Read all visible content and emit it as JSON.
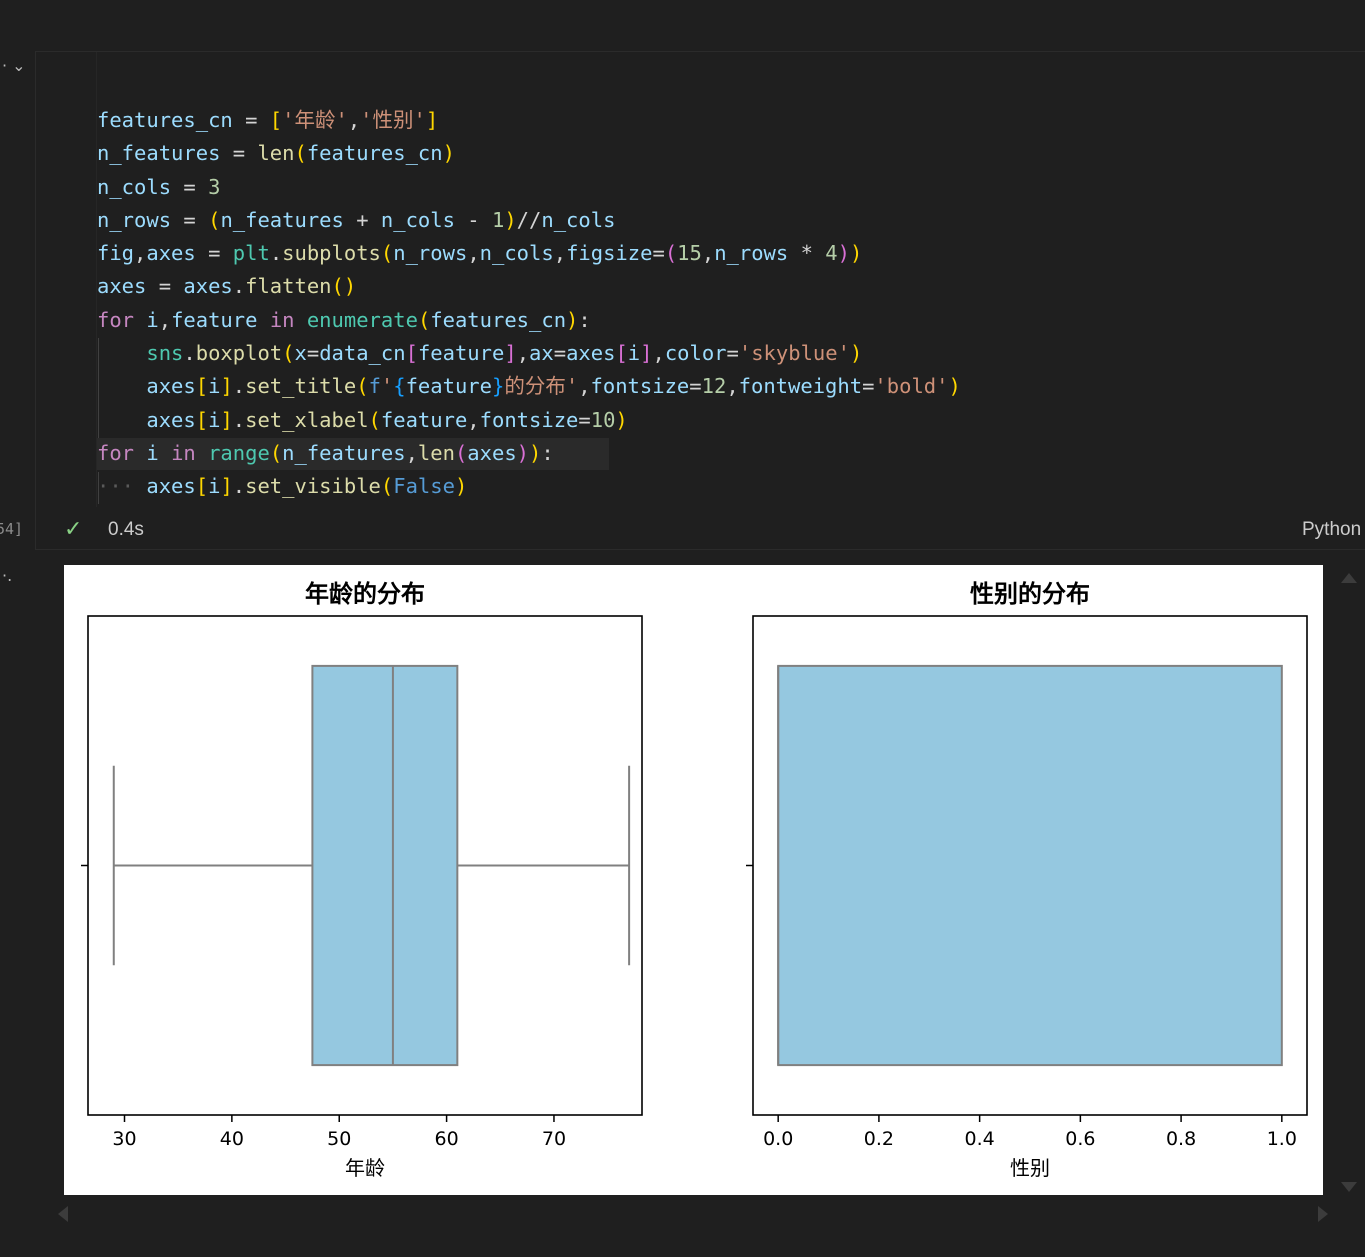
{
  "cell": {
    "execution_count": "54]",
    "status_time": "0.4s",
    "language": "Python",
    "code_lines": [
      [
        [
          "v",
          "features_cn"
        ],
        [
          "o",
          " = "
        ],
        [
          "p1",
          "["
        ],
        [
          "s",
          "'年龄'"
        ],
        [
          "o",
          ","
        ],
        [
          "s",
          "'性别'"
        ],
        [
          "p1",
          "]"
        ]
      ],
      [
        [
          "v",
          "n_features"
        ],
        [
          "o",
          " = "
        ],
        [
          "f",
          "len"
        ],
        [
          "p1",
          "("
        ],
        [
          "v",
          "features_cn"
        ],
        [
          "p1",
          ")"
        ]
      ],
      [
        [
          "v",
          "n_cols"
        ],
        [
          "o",
          " = "
        ],
        [
          "n",
          "3"
        ]
      ],
      [
        [
          "v",
          "n_rows"
        ],
        [
          "o",
          " = "
        ],
        [
          "p1",
          "("
        ],
        [
          "v",
          "n_features"
        ],
        [
          "o",
          " + "
        ],
        [
          "v",
          "n_cols"
        ],
        [
          "o",
          " - "
        ],
        [
          "n",
          "1"
        ],
        [
          "p1",
          ")"
        ],
        [
          "o",
          "//"
        ],
        [
          "v",
          "n_cols"
        ]
      ],
      [
        [
          "v",
          "fig"
        ],
        [
          "o",
          ","
        ],
        [
          "v",
          "axes"
        ],
        [
          "o",
          " = "
        ],
        [
          "c",
          "plt"
        ],
        [
          "o",
          "."
        ],
        [
          "f",
          "subplots"
        ],
        [
          "p1",
          "("
        ],
        [
          "v",
          "n_rows"
        ],
        [
          "o",
          ","
        ],
        [
          "v",
          "n_cols"
        ],
        [
          "o",
          ","
        ],
        [
          "v",
          "figsize"
        ],
        [
          "o",
          "="
        ],
        [
          "p2",
          "("
        ],
        [
          "n",
          "15"
        ],
        [
          "o",
          ","
        ],
        [
          "v",
          "n_rows"
        ],
        [
          "o",
          " * "
        ],
        [
          "n",
          "4"
        ],
        [
          "p2",
          ")"
        ],
        [
          "p1",
          ")"
        ]
      ],
      [
        [
          "v",
          "axes"
        ],
        [
          "o",
          " = "
        ],
        [
          "v",
          "axes"
        ],
        [
          "o",
          "."
        ],
        [
          "f",
          "flatten"
        ],
        [
          "p1",
          "()"
        ]
      ],
      [
        [
          "k",
          "for"
        ],
        [
          "o",
          " "
        ],
        [
          "v",
          "i"
        ],
        [
          "o",
          ","
        ],
        [
          "v",
          "feature"
        ],
        [
          "o",
          " "
        ],
        [
          "k",
          "in"
        ],
        [
          "o",
          " "
        ],
        [
          "c",
          "enumerate"
        ],
        [
          "p1",
          "("
        ],
        [
          "v",
          "features_cn"
        ],
        [
          "p1",
          ")"
        ],
        [
          "o",
          ":"
        ]
      ],
      [
        [
          "o",
          "    "
        ],
        [
          "c",
          "sns"
        ],
        [
          "o",
          "."
        ],
        [
          "f",
          "boxplot"
        ],
        [
          "p1",
          "("
        ],
        [
          "v",
          "x"
        ],
        [
          "o",
          "="
        ],
        [
          "v",
          "data_cn"
        ],
        [
          "p2",
          "["
        ],
        [
          "v",
          "feature"
        ],
        [
          "p2",
          "]"
        ],
        [
          "o",
          ","
        ],
        [
          "v",
          "ax"
        ],
        [
          "o",
          "="
        ],
        [
          "v",
          "axes"
        ],
        [
          "p2",
          "["
        ],
        [
          "v",
          "i"
        ],
        [
          "p2",
          "]"
        ],
        [
          "o",
          ","
        ],
        [
          "v",
          "color"
        ],
        [
          "o",
          "="
        ],
        [
          "s",
          "'skyblue'"
        ],
        [
          "p1",
          ")"
        ]
      ],
      [
        [
          "o",
          "    "
        ],
        [
          "v",
          "axes"
        ],
        [
          "p1",
          "["
        ],
        [
          "v",
          "i"
        ],
        [
          "p1",
          "]"
        ],
        [
          "o",
          "."
        ],
        [
          "f",
          "set_title"
        ],
        [
          "p1",
          "("
        ],
        [
          "b",
          "f"
        ],
        [
          "s",
          "'"
        ],
        [
          "p3",
          "{"
        ],
        [
          "v",
          "feature"
        ],
        [
          "p3",
          "}"
        ],
        [
          "s",
          "的分布'"
        ],
        [
          "o",
          ","
        ],
        [
          "v",
          "fontsize"
        ],
        [
          "o",
          "="
        ],
        [
          "n",
          "12"
        ],
        [
          "o",
          ","
        ],
        [
          "v",
          "fontweight"
        ],
        [
          "o",
          "="
        ],
        [
          "s",
          "'bold'"
        ],
        [
          "p1",
          ")"
        ]
      ],
      [
        [
          "o",
          "    "
        ],
        [
          "v",
          "axes"
        ],
        [
          "p1",
          "["
        ],
        [
          "v",
          "i"
        ],
        [
          "p1",
          "]"
        ],
        [
          "o",
          "."
        ],
        [
          "f",
          "set_xlabel"
        ],
        [
          "p1",
          "("
        ],
        [
          "v",
          "feature"
        ],
        [
          "o",
          ","
        ],
        [
          "v",
          "fontsize"
        ],
        [
          "o",
          "="
        ],
        [
          "n",
          "10"
        ],
        [
          "p1",
          ")"
        ]
      ],
      [
        [
          "k",
          "for"
        ],
        [
          "o",
          " "
        ],
        [
          "v",
          "i"
        ],
        [
          "o",
          " "
        ],
        [
          "k",
          "in"
        ],
        [
          "o",
          " "
        ],
        [
          "c",
          "range"
        ],
        [
          "p1",
          "("
        ],
        [
          "v",
          "n_features"
        ],
        [
          "o",
          ","
        ],
        [
          "f",
          "len"
        ],
        [
          "p2",
          "("
        ],
        [
          "v",
          "axes"
        ],
        [
          "p2",
          ")"
        ],
        [
          "p1",
          ")"
        ],
        [
          "o",
          ":"
        ]
      ],
      [
        [
          "dots",
          "···"
        ],
        [
          "o",
          " "
        ],
        [
          "v",
          "axes"
        ],
        [
          "p1",
          "["
        ],
        [
          "v",
          "i"
        ],
        [
          "p1",
          "]"
        ],
        [
          "o",
          "."
        ],
        [
          "f",
          "set_visible"
        ],
        [
          "p1",
          "("
        ],
        [
          "b",
          "False"
        ],
        [
          "p1",
          ")"
        ]
      ]
    ]
  },
  "chart_data": [
    {
      "type": "box",
      "title": "年龄的分布",
      "xlabel": "年龄",
      "xlim": [
        26.6,
        78.2
      ],
      "ticks": [
        30,
        40,
        50,
        60,
        70
      ],
      "tick_labels": [
        "30",
        "40",
        "50",
        "60",
        "70"
      ],
      "box": {
        "whisker_low": 29,
        "q1": 47.5,
        "median": 55,
        "q3": 61,
        "whisker_high": 77
      },
      "color": "#95c8e0",
      "edge_color": "#808080"
    },
    {
      "type": "box",
      "title": "性别的分布",
      "xlabel": "性别",
      "xlim": [
        -0.05,
        1.05
      ],
      "ticks": [
        0,
        0.2,
        0.4,
        0.6,
        0.8,
        1.0
      ],
      "tick_labels": [
        "0.0",
        "0.2",
        "0.4",
        "0.6",
        "0.8",
        "1.0"
      ],
      "box": {
        "whisker_low": 0,
        "q1": 0,
        "median": 0,
        "q3": 1,
        "whisker_high": 1
      },
      "color": "#95c8e0",
      "edge_color": "#808080"
    }
  ]
}
